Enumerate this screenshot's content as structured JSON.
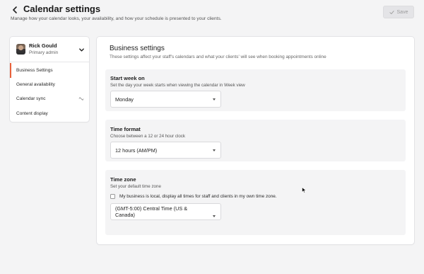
{
  "header": {
    "title": "Calendar settings",
    "subtitle": "Manage how your calendar looks, your availability, and how your schedule is presented to your clients.",
    "save_label": "Save"
  },
  "sidebar": {
    "user": {
      "name": "Rick Gould",
      "role": "Primary admin"
    },
    "items": [
      {
        "label": "Business Settings",
        "active": true
      },
      {
        "label": "General availability",
        "active": false
      },
      {
        "label": "Calendar sync",
        "active": false
      },
      {
        "label": "Content display",
        "active": false
      }
    ]
  },
  "main": {
    "title": "Business settings",
    "description": "These settings affect your staff's calendars and what your clients' will see when booking appointments online",
    "sections": {
      "start_week": {
        "title": "Start week on",
        "description": "Set the day your week starts when viewing the calendar in Week view",
        "value": "Monday"
      },
      "time_format": {
        "title": "Time format",
        "description": "Choose between a 12 or 24 hour clock",
        "value": "12 hours (AM/PM)"
      },
      "time_zone": {
        "title": "Time zone",
        "description": "Set your default time zone",
        "checkbox_label": "My business is local, display all times for staff and clients in my own time zone.",
        "checkbox_checked": false,
        "value_line1": "(GMT-5:00) Central Time (US &",
        "value_line2": "Canada)"
      }
    }
  },
  "colors": {
    "accent": "#e8613a",
    "background": "#f4f4f5",
    "section_bg": "#f4f4f5"
  },
  "icons": {
    "back": "chevron-left-icon",
    "save": "check-icon",
    "user_menu": "chevron-down-icon",
    "calendar_sync": "sync-status-icon",
    "select": "caret-down-icon"
  }
}
